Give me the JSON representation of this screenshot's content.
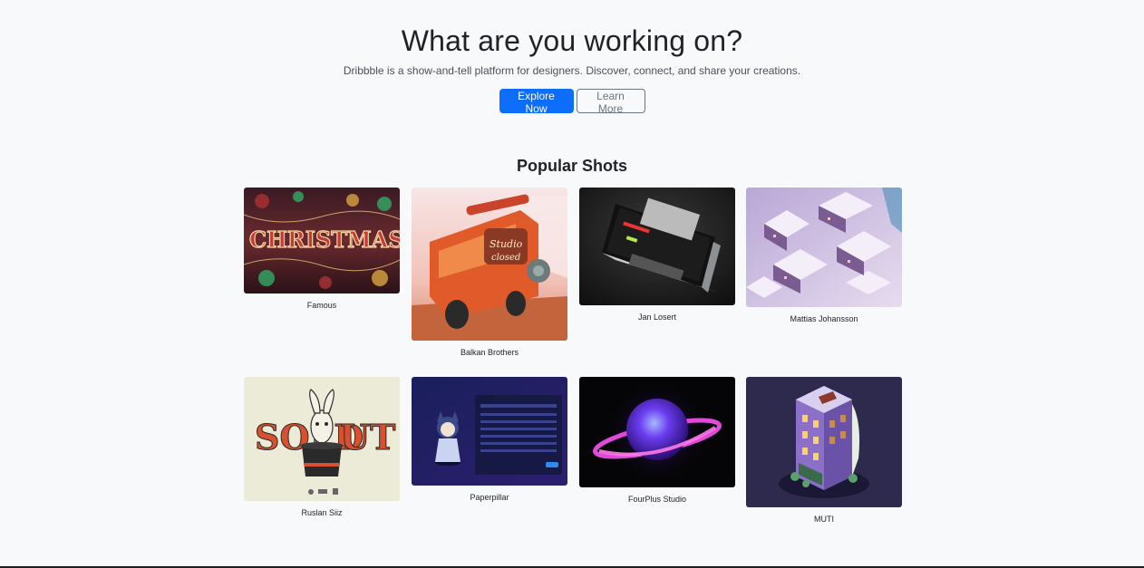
{
  "hero": {
    "title": "What are you working on?",
    "subtitle": "Dribbble is a show-and-tell platform for designers. Discover, connect, and share your creations.",
    "primary_button": "Explore Now",
    "secondary_button": "Learn More"
  },
  "popular": {
    "title": "Popular Shots",
    "shots": [
      {
        "author": "Famous",
        "image": "christmas-lettering-artwork"
      },
      {
        "author": "Balkan Brothers",
        "image": "studio-closed-van-illustration"
      },
      {
        "author": "Jan Losert",
        "image": "laptop-mockup"
      },
      {
        "author": "Mattias Johansson",
        "image": "snowy-village-3d"
      },
      {
        "author": "Ruslan Siiz",
        "image": "sold-out-rabbit-poster"
      },
      {
        "author": "Paperpillar",
        "image": "dashboard-character-ui"
      },
      {
        "author": "FourPlus Studio",
        "image": "glowing-planet-render"
      },
      {
        "author": "MUTI",
        "image": "isometric-building"
      }
    ]
  },
  "colors": {
    "background": "#f8f9fb",
    "primary": "#0d6efd",
    "outline": "#6c757d"
  }
}
